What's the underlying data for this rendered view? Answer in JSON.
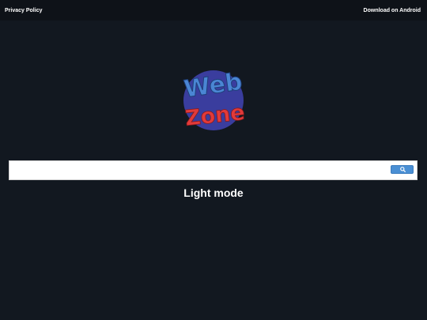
{
  "header": {
    "privacy_label": "Privacy Policy",
    "android_label": "Download on Android"
  },
  "logo": {
    "line1": "Web",
    "line2": "Zone",
    "circle_color": "#3a3d9e",
    "web_color": "#4a86d4",
    "zone_color": "#e23a3a"
  },
  "search": {
    "value": "",
    "placeholder": "",
    "button_icon": "search-icon",
    "button_color": "#4a8fd4"
  },
  "mode_toggle": {
    "label": "Light mode"
  },
  "colors": {
    "background": "#121820",
    "topbar": "#0e1218"
  }
}
